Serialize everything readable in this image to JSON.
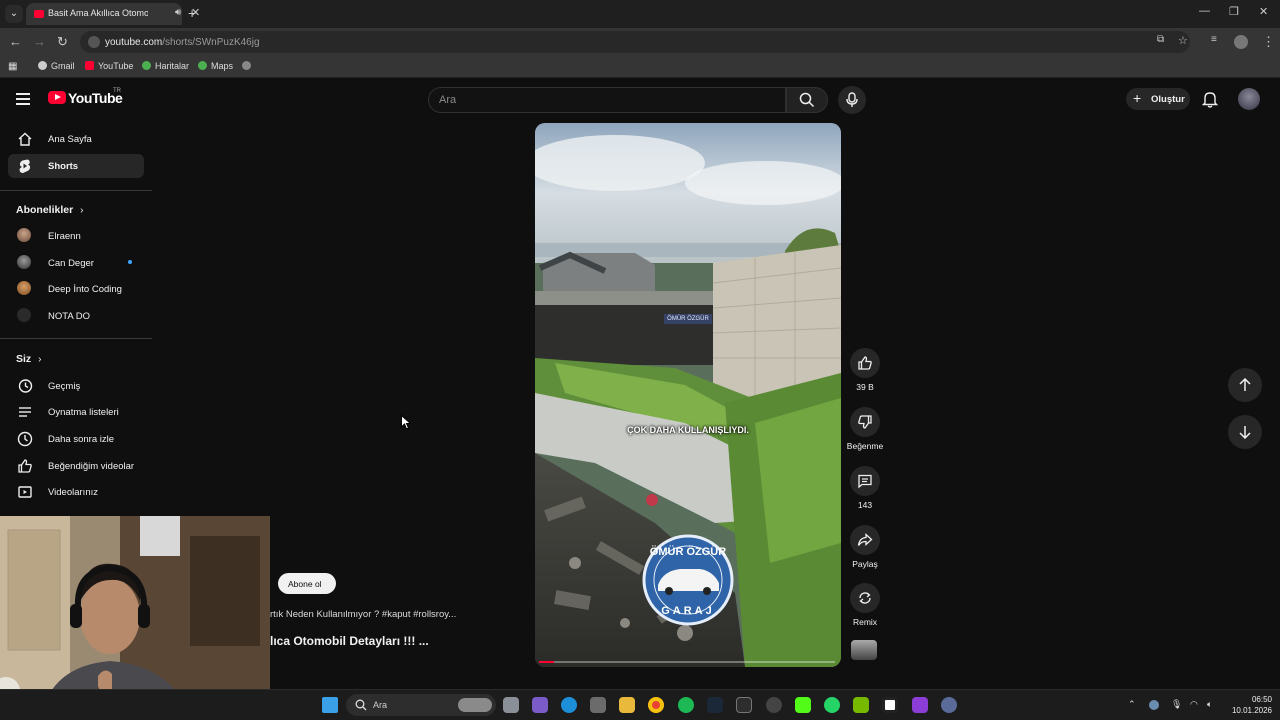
{
  "browser": {
    "tab_title": "Basit Ama Akıllıca Otomobil",
    "url_host": "youtube.com",
    "url_path": "/shorts/SWnPuzK46jg",
    "bookmarks": [
      "Gmail",
      "YouTube",
      "Haritalar",
      "Maps"
    ]
  },
  "header": {
    "logo_text": "YouTube",
    "country_code": "TR",
    "search_placeholder": "Ara",
    "create_label": "Oluştur"
  },
  "sidebar": {
    "main_items": [
      {
        "label": "Ana Sayfa",
        "icon": "home-icon"
      },
      {
        "label": "Shorts",
        "icon": "shorts-icon",
        "active": true
      }
    ],
    "subscriptions_title": "Abonelikler",
    "subscriptions": [
      {
        "label": "Elraenn"
      },
      {
        "label": "Can Deger",
        "live": true
      },
      {
        "label": "Deep İnto Coding"
      },
      {
        "label": "NOTA DO"
      }
    ],
    "you_title": "Siz",
    "you_items": [
      {
        "label": "Geçmiş",
        "icon": "history-icon"
      },
      {
        "label": "Oynatma listeleri",
        "icon": "playlist-icon"
      },
      {
        "label": "Daha sonra izle",
        "icon": "clock-icon"
      },
      {
        "label": "Beğendiğim videolar",
        "icon": "like-icon"
      },
      {
        "label": "Videolarınız",
        "icon": "video-icon"
      }
    ]
  },
  "video": {
    "caption": "ÇOK DAHA KULLANIŞLIYDI.",
    "watermark": "ÖMÜR ÖZGÜR",
    "logo_top": "ÖMÜR ÖZGÜR",
    "logo_bottom": "GARAJ",
    "progress": 0.05
  },
  "actions": {
    "like_count": "39 B",
    "dislike_label": "Beğenme",
    "comment_count": "143",
    "share_label": "Paylaş",
    "remix_label": "Remix"
  },
  "overlay": {
    "subscribe_label": "Abone ol",
    "description": "rtık Neden Kullanılmıyor ? #kaput #rollsroy...",
    "title": "lıca Otomobil Detayları !!! ..."
  },
  "taskbar": {
    "search_placeholder": "Ara",
    "time": "06:50",
    "date": "10.01.2026"
  },
  "colors": {
    "brand_red": "#ff0033",
    "background": "#0f0f0f",
    "chip": "#272727"
  }
}
